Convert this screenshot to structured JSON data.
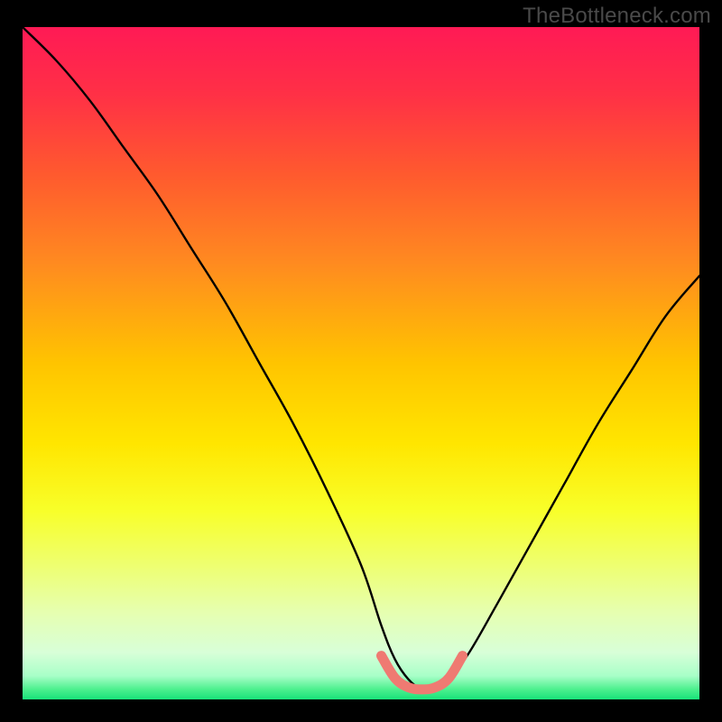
{
  "watermark": "TheBottleneck.com",
  "colors": {
    "background": "#000000",
    "gradient_stops": [
      {
        "offset": 0.0,
        "color": "#ff1a55"
      },
      {
        "offset": 0.1,
        "color": "#ff3046"
      },
      {
        "offset": 0.22,
        "color": "#ff5a2e"
      },
      {
        "offset": 0.35,
        "color": "#ff8a20"
      },
      {
        "offset": 0.5,
        "color": "#ffc400"
      },
      {
        "offset": 0.62,
        "color": "#ffe600"
      },
      {
        "offset": 0.72,
        "color": "#f8ff2a"
      },
      {
        "offset": 0.8,
        "color": "#eeff70"
      },
      {
        "offset": 0.87,
        "color": "#e6ffb0"
      },
      {
        "offset": 0.93,
        "color": "#d8ffd8"
      },
      {
        "offset": 0.965,
        "color": "#a8ffc8"
      },
      {
        "offset": 0.985,
        "color": "#4cf08e"
      },
      {
        "offset": 1.0,
        "color": "#18e27a"
      }
    ],
    "curve": "#000000",
    "accent_curve": "#ef7a72",
    "accent_curve_dark": "#d66a63"
  },
  "chart_data": {
    "type": "line",
    "title": "",
    "xlabel": "",
    "ylabel": "",
    "xlim": [
      0,
      100
    ],
    "ylim": [
      0,
      100
    ],
    "series": [
      {
        "name": "bottleneck-curve",
        "x": [
          0,
          5,
          10,
          15,
          20,
          25,
          30,
          35,
          40,
          45,
          50,
          53,
          55,
          57,
          59,
          61,
          63,
          66,
          70,
          75,
          80,
          85,
          90,
          95,
          100
        ],
        "y": [
          100,
          95,
          89,
          82,
          75,
          67,
          59,
          50,
          41,
          31,
          20,
          11,
          6,
          3,
          1.5,
          1.5,
          3,
          7,
          14,
          23,
          32,
          41,
          49,
          57,
          63
        ]
      },
      {
        "name": "optimal-range",
        "x": [
          53,
          55,
          57,
          59,
          61,
          63,
          65
        ],
        "y": [
          6.5,
          3.2,
          1.8,
          1.5,
          1.8,
          3.2,
          6.5
        ]
      }
    ],
    "annotations": []
  }
}
